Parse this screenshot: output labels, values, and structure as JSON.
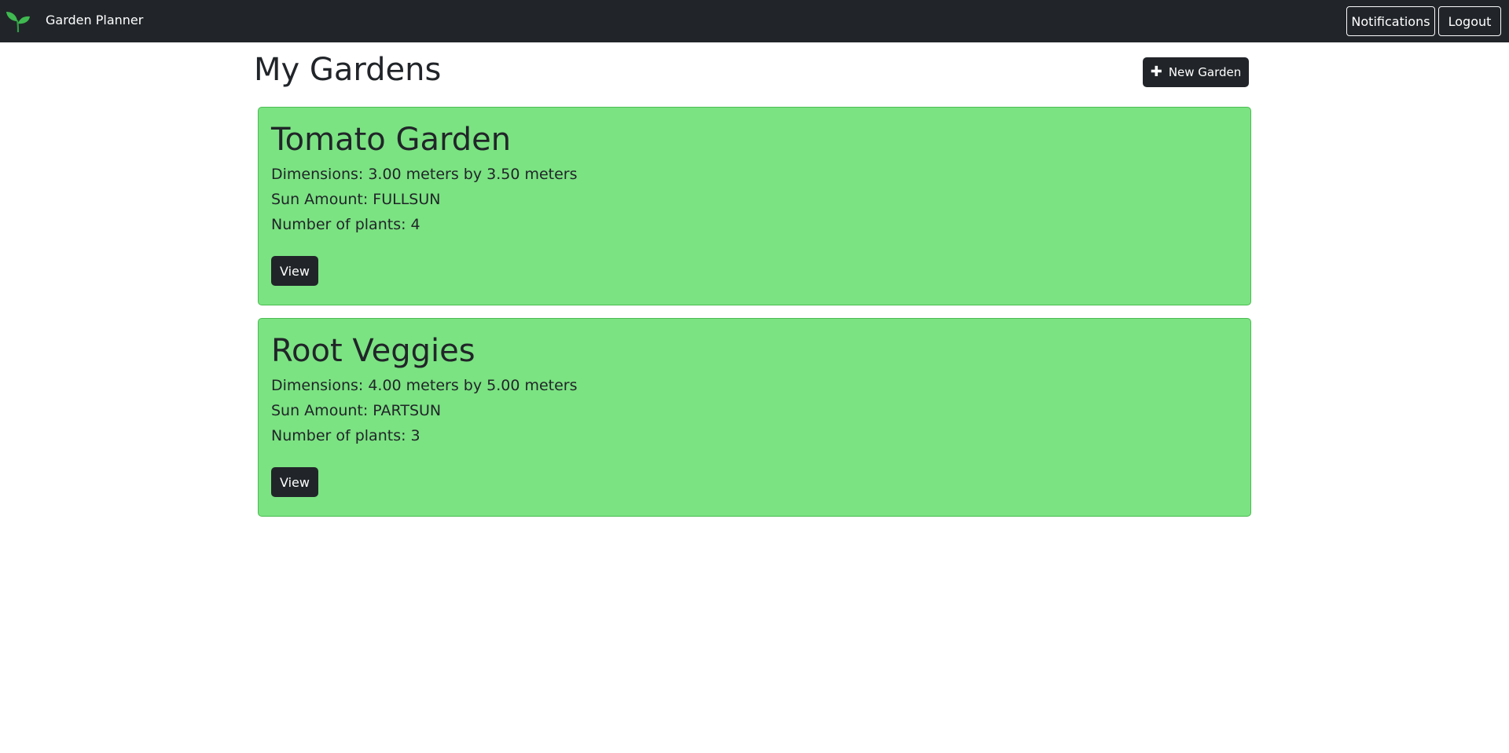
{
  "navbar": {
    "brand": "Garden Planner",
    "logo_icon": "sprout-icon",
    "notifications_label": "Notifications",
    "logout_label": "Logout",
    "background": "#212529"
  },
  "header": {
    "title": "My Gardens",
    "new_garden_label": "New Garden",
    "new_garden_icon": "plus-icon"
  },
  "gardens": [
    {
      "name": "Tomato Garden",
      "dimensions": "Dimensions: 3.00 meters by 3.50 meters",
      "sun": "Sun Amount: FULLSUN",
      "plants": "Number of plants: 4",
      "view_label": "View"
    },
    {
      "name": "Root Veggies",
      "dimensions": "Dimensions: 4.00 meters by 5.00 meters",
      "sun": "Sun Amount: PARTSUN",
      "plants": "Number of plants: 3",
      "view_label": "View"
    }
  ],
  "colors": {
    "card_background": "#7be382",
    "card_border": "#4cbc52",
    "button_dark": "#212529"
  }
}
